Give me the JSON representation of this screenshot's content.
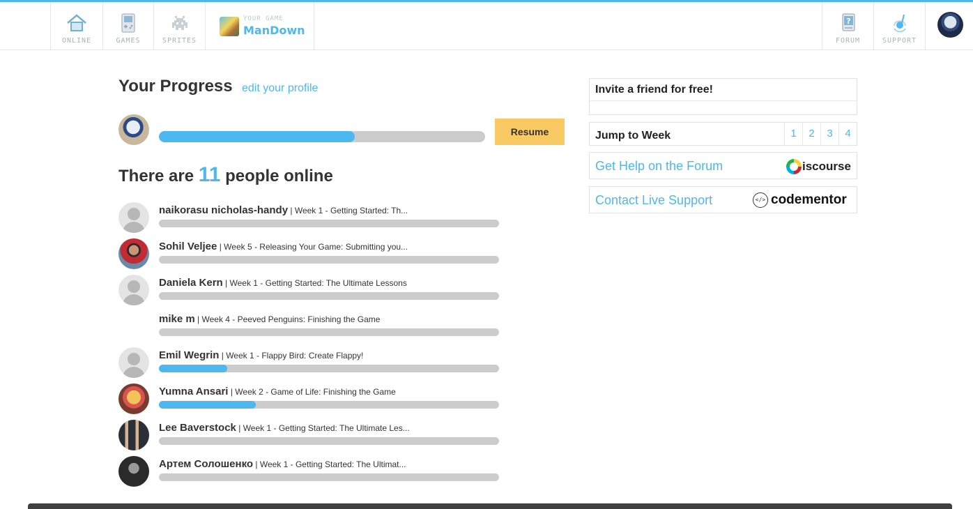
{
  "nav": {
    "items": [
      {
        "label": "ONLINE",
        "icon": "home-icon"
      },
      {
        "label": "GAMES",
        "icon": "gameboy-icon"
      },
      {
        "label": "SPRITES",
        "icon": "space-invader-icon"
      },
      {
        "label": "FORUM",
        "icon": "forum-question-icon"
      },
      {
        "label": "SUPPORT",
        "icon": "headset-icon"
      }
    ],
    "game_caption": "YOUR GAME",
    "game_name": "ManDown"
  },
  "progress": {
    "title": "Your Progress",
    "edit_link": "edit your profile",
    "percent": 60,
    "resume_label": "Resume"
  },
  "online": {
    "prefix": "There are",
    "count": "11",
    "suffix": "people online",
    "users": [
      {
        "name": "naikorasu nicholas-handy",
        "status": "| Week 1 - Getting Started: Th...",
        "progress": 0,
        "avatar": "generic"
      },
      {
        "name": "Sohil Veljee",
        "status": "| Week 5 - Releasing Your Game: Submitting you...",
        "progress": 0,
        "avatar": "photo"
      },
      {
        "name": "Daniela Kern",
        "status": "| Week 1 - Getting Started: The Ultimate Lessons",
        "progress": 0,
        "avatar": "generic"
      },
      {
        "name": "mike m",
        "status": "| Week 4 - Peeved Penguins: Finishing the Game",
        "progress": 0,
        "avatar": "none"
      },
      {
        "name": "Emil Wegrin",
        "status": "| Week 1 - Flappy Bird: Create Flappy!",
        "progress": 20,
        "avatar": "generic"
      },
      {
        "name": "Yumna Ansari",
        "status": "| Week 2 - Game of Life: Finishing the Game",
        "progress": 28.5,
        "avatar": "photo"
      },
      {
        "name": "Lee Baverstock",
        "status": "| Week 1 - Getting Started: The Ultimate Les...",
        "progress": 0,
        "avatar": "photo"
      },
      {
        "name": "Артем Солошенко",
        "status": "| Week 1 - Getting Started: The Ultimat...",
        "progress": 0,
        "avatar": "photo"
      }
    ]
  },
  "sidebar": {
    "invite_title": "Invite a friend for free!",
    "jump_title": "Jump to Week",
    "weeks": [
      "1",
      "2",
      "3",
      "4"
    ],
    "forum_link": "Get Help on the Forum",
    "discourse_text": "iscourse",
    "support_link": "Contact Live Support",
    "codementor_text": "codementor",
    "codementor_glyph": "</>"
  },
  "colors": {
    "accent": "#4db8f0",
    "resume": "#f9c963",
    "track": "#cccccc"
  }
}
